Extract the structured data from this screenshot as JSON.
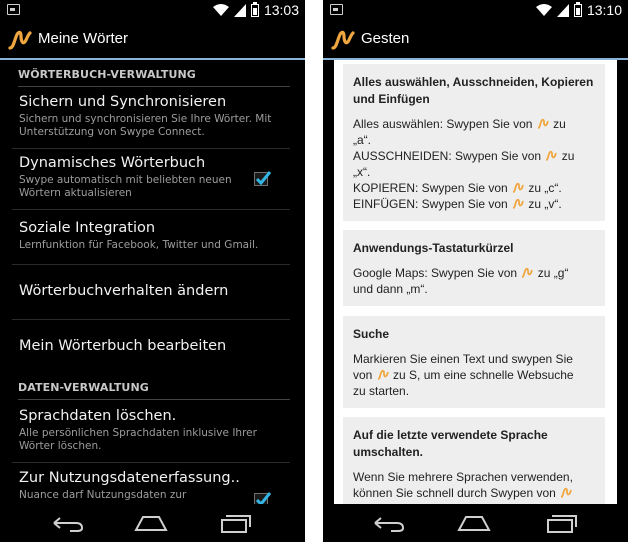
{
  "left": {
    "status_time": "13:03",
    "title": "Meine Wörter",
    "sections": [
      {
        "header": "WÖRTERBUCH-VERWALTUNG"
      },
      {
        "header": "DATEN-VERWALTUNG"
      }
    ],
    "items": [
      {
        "title": "Sichern und Synchronisieren",
        "summary": "Sichern und synchronisieren Sie Ihre Wörter. Mit Unterstützung von Swype Connect."
      },
      {
        "title": "Dynamisches Wörterbuch",
        "summary": "Swype automatisch mit beliebten neuen Wörtern aktualisieren",
        "checked": true
      },
      {
        "title": "Soziale Integration",
        "summary": "Lernfunktion für Facebook, Twitter und Gmail."
      },
      {
        "title": "Wörterbuchverhalten ändern"
      },
      {
        "title": "Mein Wörterbuch bearbeiten"
      },
      {
        "title": "Sprachdaten löschen.",
        "summary": "Alle persönlichen Sprachdaten inklusive Ihrer Wörter löschen."
      },
      {
        "title": "Zur Nutzungsdatenerfassung..",
        "summary": "Nuance darf Nutzungsdaten zur",
        "checked": true
      }
    ]
  },
  "right": {
    "status_time": "13:10",
    "title": "Gesten",
    "cards": [
      {
        "title_lines": [
          "Alles auswählen, Ausschneiden, Kopieren",
          "und Einfügen"
        ],
        "lines": [
          [
            "Alles auswählen: Swypen Sie von",
            "zu"
          ],
          [
            "„a“."
          ],
          [
            "AUSSCHNEIDEN: Swypen Sie von",
            "zu"
          ],
          [
            "„x“."
          ],
          [
            "KOPIEREN: Swypen Sie von",
            "zu „c“."
          ],
          [
            "EINFÜGEN: Swypen Sie von",
            "zu „v“."
          ]
        ]
      },
      {
        "title_lines": [
          "Anwendungs-Tastaturkürzel"
        ],
        "lines": [
          [
            "Google Maps: Swypen Sie von",
            "zu „g“"
          ],
          [
            "und dann „m“."
          ]
        ]
      },
      {
        "title_lines": [
          "Suche"
        ],
        "lines": [
          [
            "Markieren Sie einen Text und swypen Sie"
          ],
          [
            "von",
            "zu S, um eine schnelle Websuche"
          ],
          [
            "zu starten."
          ]
        ]
      },
      {
        "title_lines": [
          "Auf die letzte verwendete Sprache",
          "umschalten."
        ],
        "lines": [
          [
            "Wenn Sie mehrere Sprachen verwenden,"
          ],
          [
            "können Sie schnell durch Swypen von"
          ]
        ]
      }
    ]
  },
  "colors": {
    "accent": "#8bb3d7",
    "checkbox_check": "#33b5e5",
    "swype_orange": "#f0a640"
  }
}
